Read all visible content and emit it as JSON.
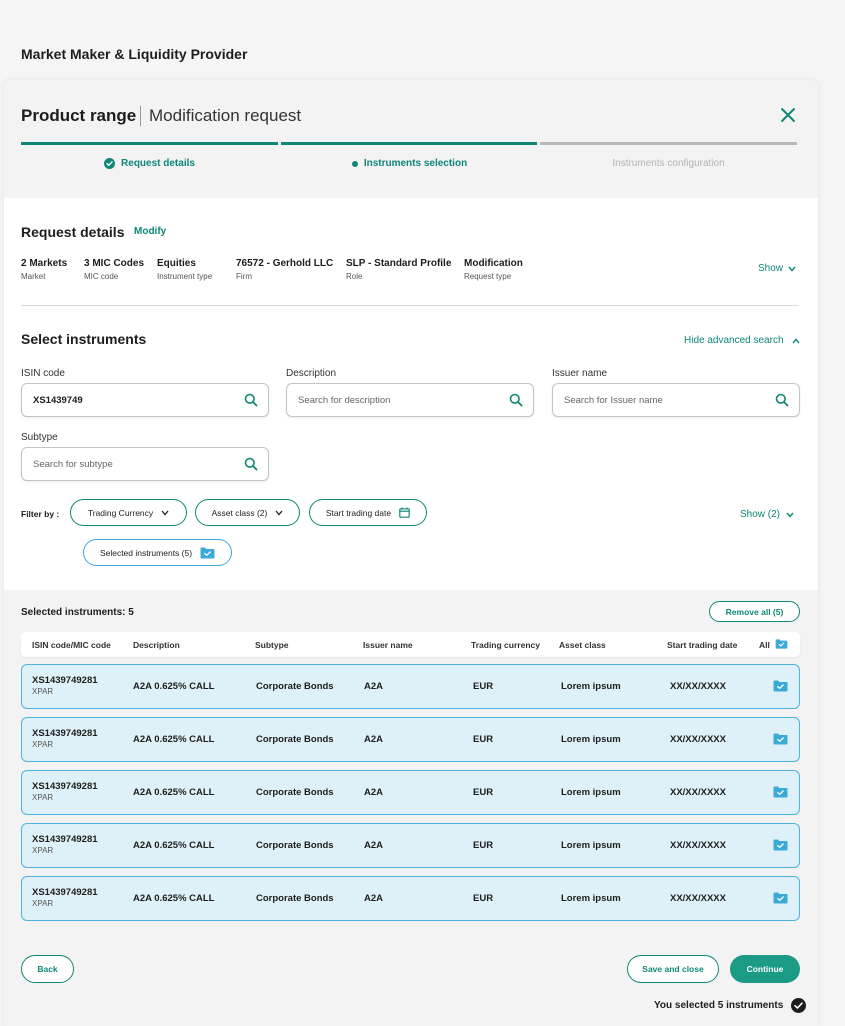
{
  "app": {
    "title": "Market Maker & Liquidity Provider"
  },
  "modal": {
    "title": "Product range",
    "subtitle": "Modification request"
  },
  "steps": [
    {
      "label": "Request details",
      "state": "done"
    },
    {
      "label": "Instruments selection",
      "state": "active"
    },
    {
      "label": "Instruments configuration",
      "state": "todo"
    }
  ],
  "request_details": {
    "title": "Request details",
    "modify_label": "Modify",
    "show_label": "Show",
    "items": [
      {
        "value": "2 Markets",
        "label": "Market"
      },
      {
        "value": "3 MIC Codes",
        "label": "MIC code"
      },
      {
        "value": "Equities",
        "label": "Instrument type"
      },
      {
        "value": "76572 - Gerhold LLC",
        "label": "Firm"
      },
      {
        "value": "SLP - Standard Profile",
        "label": "Role"
      },
      {
        "value": "Modification",
        "label": "Request type"
      }
    ]
  },
  "select_instruments": {
    "title": "Select instruments",
    "hide_advanced_label": "Hide advanced search",
    "fields": {
      "isin": {
        "label": "ISIN code",
        "value": "XS1439749"
      },
      "description": {
        "label": "Description",
        "placeholder": "Search for description"
      },
      "issuer": {
        "label": "Issuer name",
        "placeholder": "Search for Issuer name"
      },
      "subtype": {
        "label": "Subtype",
        "placeholder": "Search for subtype"
      }
    },
    "filter_by_label": "Filter by :",
    "filters": {
      "trading_currency": "Trading Currency",
      "asset_class": "Asset class (2)",
      "start_trading_date": "Start trading date",
      "selected_instruments": "Selected instruments (5)"
    },
    "show_filters_label": "Show (2)"
  },
  "selected": {
    "title": "Selected instruments: 5",
    "remove_all_label": "Remove all (5)",
    "columns": [
      "ISIN code/MIC code",
      "Description",
      "Subtype",
      "Issuer name",
      "Trading currency",
      "Asset class",
      "Start trading date",
      "All"
    ],
    "rows": [
      {
        "isin": "XS1439749281",
        "mic": "XPAR",
        "description": "A2A 0.625% CALL",
        "subtype": "Corporate Bonds",
        "issuer": "A2A",
        "currency": "EUR",
        "asset_class": "Lorem ipsum",
        "start_date": "XX/XX/XXXX"
      },
      {
        "isin": "XS1439749281",
        "mic": "XPAR",
        "description": "A2A 0.625% CALL",
        "subtype": "Corporate Bonds",
        "issuer": "A2A",
        "currency": "EUR",
        "asset_class": "Lorem ipsum",
        "start_date": "XX/XX/XXXX"
      },
      {
        "isin": "XS1439749281",
        "mic": "XPAR",
        "description": "A2A 0.625% CALL",
        "subtype": "Corporate Bonds",
        "issuer": "A2A",
        "currency": "EUR",
        "asset_class": "Lorem ipsum",
        "start_date": "XX/XX/XXXX"
      },
      {
        "isin": "XS1439749281",
        "mic": "XPAR",
        "description": "A2A 0.625% CALL",
        "subtype": "Corporate Bonds",
        "issuer": "A2A",
        "currency": "EUR",
        "asset_class": "Lorem ipsum",
        "start_date": "XX/XX/XXXX"
      },
      {
        "isin": "XS1439749281",
        "mic": "XPAR",
        "description": "A2A 0.625% CALL",
        "subtype": "Corporate Bonds",
        "issuer": "A2A",
        "currency": "EUR",
        "asset_class": "Lorem ipsum",
        "start_date": "XX/XX/XXXX"
      }
    ]
  },
  "footer": {
    "back_label": "Back",
    "save_close_label": "Save and close",
    "continue_label": "Continue",
    "selected_note": "You selected 5 instruments"
  },
  "colors": {
    "accent": "#0e8776",
    "selection": "#4db3df",
    "row_bg": "#dff1f8"
  },
  "icons": [
    "close-icon",
    "check-circle-icon",
    "search-icon",
    "chevron-down-icon",
    "chevron-up-icon",
    "calendar-icon",
    "folder-check-icon"
  ]
}
